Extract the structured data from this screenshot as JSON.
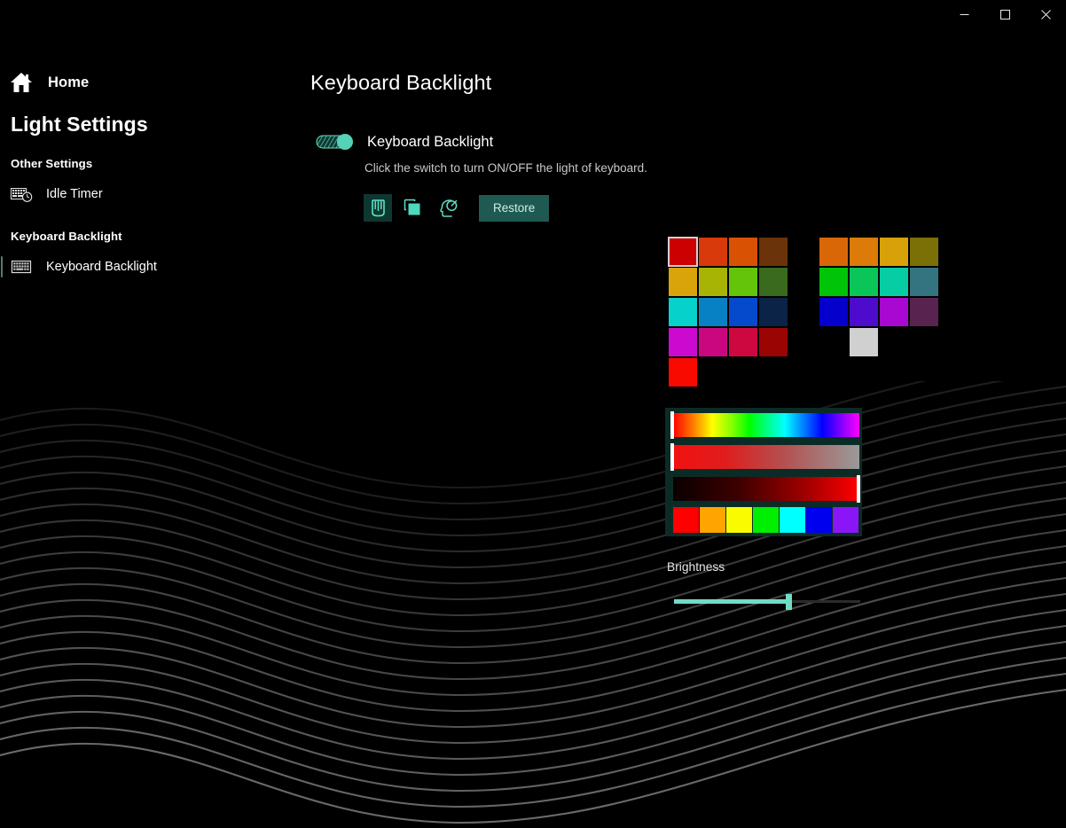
{
  "window": {
    "controls": [
      {
        "name": "minimize",
        "label": "—"
      },
      {
        "name": "maximize",
        "label": "□"
      },
      {
        "name": "close",
        "label": "✕"
      }
    ]
  },
  "sidebar": {
    "home_label": "Home",
    "home_icon": "home-icon",
    "app_title": "Light Settings",
    "groups": [
      {
        "title": "Other Settings",
        "items": [
          {
            "label": "Idle Timer",
            "icon": "keyboard-clock-icon",
            "selected": false
          }
        ]
      },
      {
        "title": "Keyboard Backlight",
        "items": [
          {
            "label": "Keyboard Backlight",
            "icon": "keyboard-icon",
            "selected": true
          }
        ]
      }
    ]
  },
  "main": {
    "page_title": "Keyboard Backlight",
    "toggle": {
      "label": "Keyboard Backlight",
      "state": "on",
      "description": "Click the switch to turn ON/OFF the light of keyboard."
    },
    "toolbar": {
      "buttons": [
        {
          "name": "paint-bucket-icon",
          "label": "Paint",
          "active": true
        },
        {
          "name": "copy-layers-icon",
          "label": "Copy",
          "active": false
        },
        {
          "name": "head-profile-icon",
          "label": "Profile",
          "active": false
        }
      ],
      "restore_label": "Restore"
    },
    "palette": {
      "selected_index": 0,
      "rows": [
        [
          "#cc0000",
          "#d93a0b",
          "#d95204",
          "#6b3309",
          null,
          "#d96708",
          "#dd7b09",
          "#d9a109",
          "#7a7005"
        ],
        [
          "#d9a409",
          "#a7b403",
          "#64c409",
          "#3a6a1e",
          null,
          "#00c408",
          "#0ac659",
          "#07cda4",
          "#337480"
        ],
        [
          "#06d1cb",
          "#0880c4",
          "#0549cc",
          "#0a2346",
          null,
          "#0600cd",
          "#4c0bcd",
          "#a808d1",
          "#59234f"
        ],
        [
          "#cb09cf",
          "#cb0780",
          "#cd0840",
          "#9a0503",
          null,
          null,
          "#d0d0d0",
          null,
          null
        ],
        [
          "#f90a00",
          null,
          null,
          null,
          null,
          null,
          null,
          null,
          null
        ]
      ]
    },
    "sliders": [
      {
        "name": "hue-slider",
        "type": "hue",
        "thumb": "left",
        "value": 0
      },
      {
        "name": "saturation-slider",
        "type": "saturation",
        "thumb": "left",
        "value": 0,
        "from": "#f21111",
        "to": "#9a9a9a"
      },
      {
        "name": "value-slider",
        "type": "value",
        "thumb": "right",
        "value": 100,
        "from": "#0a0000",
        "to": "#ff0000"
      }
    ],
    "presets": [
      "#fe0000",
      "#ffa400",
      "#fbfb00",
      "#00ee00",
      "#00ffff",
      "#0000ee",
      "#8a16f7"
    ],
    "brightness": {
      "label": "Brightness",
      "value": 62
    }
  },
  "colors": {
    "accent": "#6fdcc4",
    "accent_dark": "#1e5a51",
    "background": "#000000",
    "text": "#ffffff",
    "text_muted": "#c9c9c9"
  }
}
